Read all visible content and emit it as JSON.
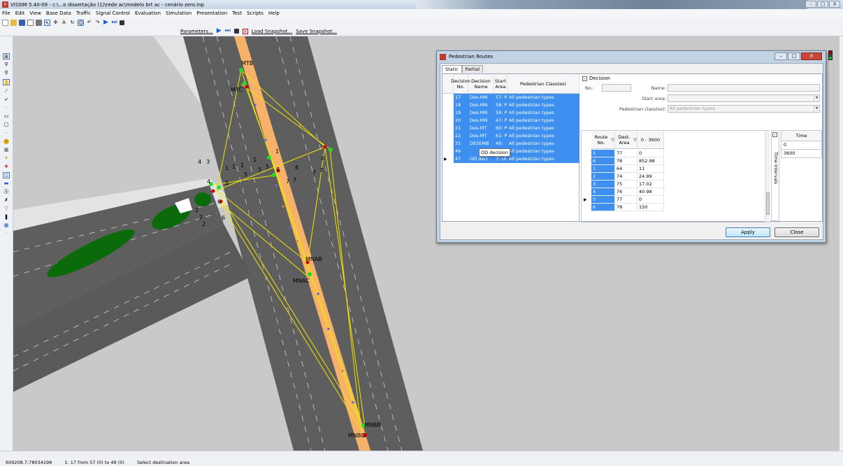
{
  "window": {
    "title": "VISSIM 5.40-09 - c:\\...o dissertação (1)\\rede ac\\modelo brt ac - cenário zero.inp",
    "app_icon": "vissim-icon",
    "buttons": [
      "–",
      "□",
      "X"
    ]
  },
  "menu": [
    "File",
    "Edit",
    "View",
    "Base Data",
    "Traffic",
    "Signal Control",
    "Evaluation",
    "Simulation",
    "Presentation",
    "Test",
    "Scripts",
    "Help"
  ],
  "toolbar2": {
    "parameters": "Parameters...",
    "load_snapshot": "Load Snapshot...",
    "save_snapshot": "Save Snapshot..."
  },
  "network_labels": {
    "top_a": "MTB",
    "top_b": "MTC",
    "mid_a": "MNAB",
    "mid_b": "MNAC",
    "bottom_a": "MNBB",
    "bottom_b": "MNBC",
    "numbers": [
      "4",
      "3",
      "1",
      "1",
      "1",
      "1",
      "5",
      "5",
      "5",
      "8",
      "8",
      "7",
      "7",
      "7",
      "7",
      "8",
      "4",
      "5",
      "6",
      "6",
      "2",
      "2",
      "2",
      "1"
    ]
  },
  "status": {
    "coords": "609208.7:78034198",
    "route_info": "1: 17 from 57 (0) to 49 (0)",
    "hint": "Select destination area"
  },
  "dialog": {
    "title": "Pedestrian Routes",
    "buttons": [
      "–",
      "□",
      "X"
    ],
    "tabs": [
      "Static",
      "Partial"
    ],
    "decision_columns": [
      "Decision No.",
      "Decision Name",
      "Start Area",
      "Pedestrian Class(es)"
    ],
    "decisions": [
      {
        "no": "17",
        "name": "Des-MN",
        "area": "57: P",
        "cls": "All pedestrian types"
      },
      {
        "no": "18",
        "name": "Des-MN",
        "area": "58: P",
        "cls": "All pedestrian types"
      },
      {
        "no": "19",
        "name": "Des-MN",
        "area": "59: P",
        "cls": "All pedestrian types"
      },
      {
        "no": "20",
        "name": "Des-MN",
        "area": "47: P",
        "cls": "All pedestrian types"
      },
      {
        "no": "21",
        "name": "Des-MT",
        "area": "60: P",
        "cls": "All pedestrian types"
      },
      {
        "no": "22",
        "name": "Des-MT",
        "area": "61: P",
        "cls": "All pedestrian types"
      },
      {
        "no": "31",
        "name": "DESEMB",
        "area": "49:",
        "cls": "All pedestrian types"
      },
      {
        "no": "46",
        "name": "",
        "area": "0",
        "cls": "All pedestrian types"
      },
      {
        "no": "47",
        "name": "OD deci",
        "area": "7: LE",
        "cls": "All pedestrian types"
      }
    ],
    "tooltip": "OD decision",
    "decision_section": {
      "header": "Decision",
      "no_label": "No.:",
      "name_label": "Name:",
      "start_area_label": "Start area:",
      "ped_class_label": "Pedestrian class(es):",
      "ped_class_value": "All pedestrian types"
    },
    "route_columns": [
      "Route No.",
      "Dest. Area",
      "0 - 3600"
    ],
    "routes": [
      {
        "no": "5",
        "dest": "77",
        "val": "0"
      },
      {
        "no": "6",
        "dest": "78",
        "val": "852.98"
      },
      {
        "no": "1",
        "dest": "64",
        "val": "11"
      },
      {
        "no": "2",
        "dest": "74",
        "val": "24.99"
      },
      {
        "no": "3",
        "dest": "75",
        "val": "17.02"
      },
      {
        "no": "4",
        "dest": "76",
        "val": "40.98"
      },
      {
        "no": "5",
        "dest": "77",
        "val": "0"
      },
      {
        "no": "6",
        "dest": "78",
        "val": "150"
      }
    ],
    "time_intervals_label": "Time Intervals",
    "time_header": "Time",
    "times": [
      "0",
      "3600"
    ],
    "apply": "Apply",
    "close": "Close"
  },
  "colors": {
    "selection": "#3d8ff0",
    "route_lines": "#f2e600",
    "busway": "#f6b26b",
    "grass": "#0b6b0b"
  }
}
